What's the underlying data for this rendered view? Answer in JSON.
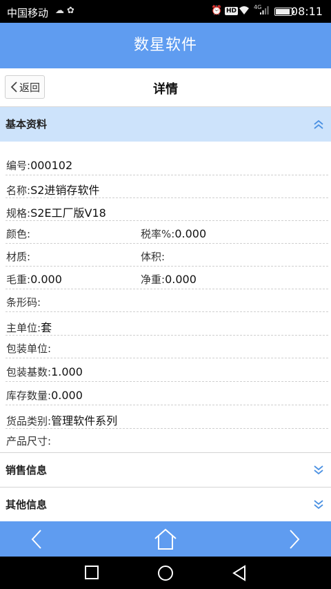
{
  "status_bar": {
    "carrier": "中国移动",
    "network": "4G",
    "hd_badge": "HD",
    "time": "08:11"
  },
  "app": {
    "title": "数星软件"
  },
  "subheader": {
    "back_label": "返回",
    "title": "详情"
  },
  "sections": {
    "basic": "基本资料",
    "sales": "销售信息",
    "other": "其他信息"
  },
  "fields": {
    "code_label": "编号:",
    "code_value": "000102",
    "name_label": "名称:",
    "name_value": "S2进销存软件",
    "spec_label": "规格:",
    "spec_value": "S2E工厂版V18",
    "color_label": "颜色:",
    "color_value": "",
    "tax_label": "税率%:",
    "tax_value": "0.000",
    "material_label": "材质:",
    "material_value": "",
    "volume_label": "体积:",
    "volume_value": "",
    "gross_label": "毛重:",
    "gross_value": "0.000",
    "net_label": "净重:",
    "net_value": "0.000",
    "barcode_label": "条形码:",
    "barcode_value": "",
    "unit_label": "主单位:",
    "unit_value": "套",
    "pack_unit_label": "包装单位:",
    "pack_unit_value": "",
    "pack_qty_label": "包装基数:",
    "pack_qty_value": "1.000",
    "stock_label": "库存数量:",
    "stock_value": "0.000",
    "category_label": "货品类别:",
    "category_value": "管理软件系列",
    "size_label": "产品尺寸:",
    "size_value": ""
  },
  "colors": {
    "accent": "#5f9cf0",
    "section_active": "#cde3fb",
    "chevron": "#4a90e2"
  },
  "icons": {
    "collapse": "double-chevron-up-icon",
    "expand": "double-chevron-down-icon",
    "prev": "chevron-left-icon",
    "home": "home-icon",
    "next": "chevron-right-icon"
  }
}
